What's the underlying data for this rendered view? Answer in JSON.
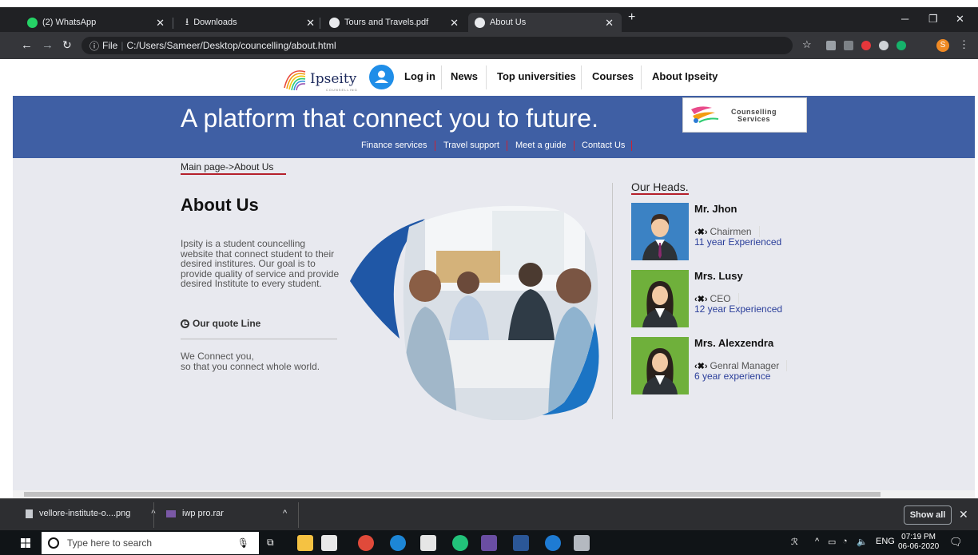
{
  "browser": {
    "tabs": [
      {
        "title": "(2) WhatsApp",
        "icon": "whatsapp-icon"
      },
      {
        "title": "Downloads",
        "icon": "download-icon"
      },
      {
        "title": "Tours and Travels.pdf",
        "icon": "chrome-icon"
      },
      {
        "title": "About Us",
        "icon": "chrome-icon"
      }
    ],
    "url_prefix": "File",
    "url": "C:/Users/Sameer/Desktop/councelling/about.html",
    "profile_initial": "S"
  },
  "site": {
    "logo_text": "Ipseity",
    "logo_sub": "COUNSELLING",
    "nav": [
      "Log in",
      "News",
      "Top universities",
      "Courses",
      "About Ipseity"
    ],
    "hero_title": "A platform that connect you to future.",
    "badge_line1": "Counselling",
    "badge_line2": "Services",
    "sub_nav": [
      "Finance services",
      "Travel support",
      "Meet a guide",
      "Contact Us"
    ],
    "breadcrumb": "Main page->About Us",
    "about": {
      "title": "About Us",
      "description": "Ipsity is a student councelling website that connect student to their desired institures. Our goal is to provide quality of service and provide desired Institute to every student.",
      "quote_label": "Our quote Line",
      "tagline_1": "We Connect you,",
      "tagline_2": "so that you connect whole world."
    },
    "heads": {
      "title": "Our Heads.",
      "people": [
        {
          "name": "Mr. Jhon",
          "role": "Chairmen",
          "experience": "11 year Experienced",
          "color": "#3b82c4"
        },
        {
          "name": "Mrs. Lusy",
          "role": "CEO",
          "experience": "12 year Experienced",
          "color": "#6fb03b"
        },
        {
          "name": "Mrs. Alexzendra",
          "role": "Genral Manager",
          "experience": "6 year experience",
          "color": "#6fb03b"
        }
      ]
    }
  },
  "downloads": {
    "items": [
      "vellore-institute-o....png",
      "iwp pro.rar"
    ],
    "show_all": "Show all"
  },
  "taskbar": {
    "search_placeholder": "Type here to search",
    "lang": "ENG",
    "time": "07:19 PM",
    "date": "06-06-2020"
  }
}
